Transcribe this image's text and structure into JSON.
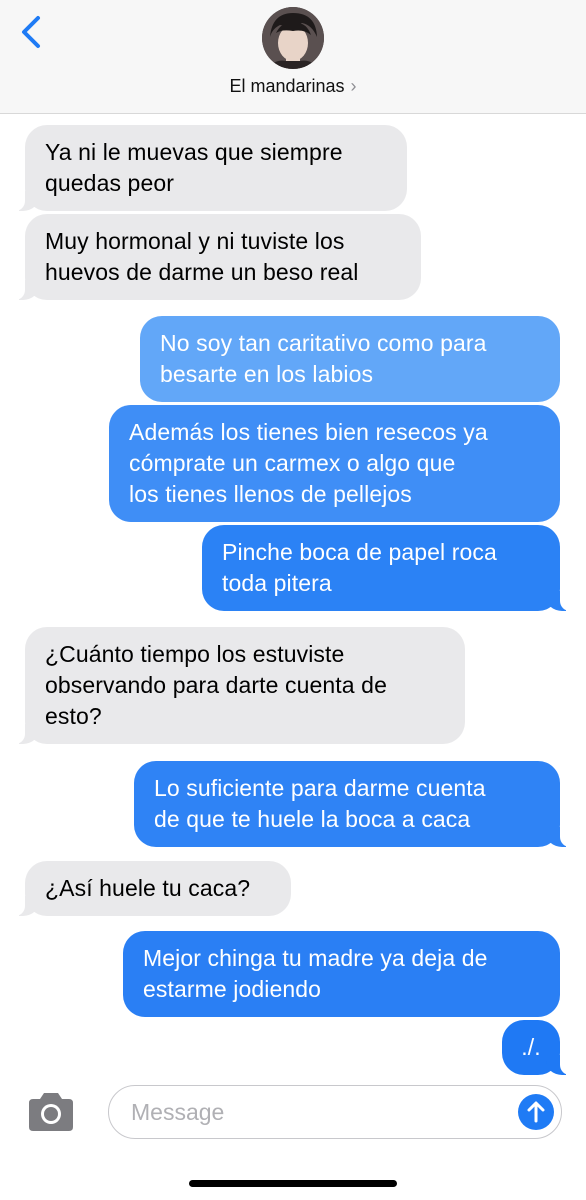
{
  "header": {
    "back_icon": "chevron-left-icon",
    "contact_name": "El mandarinas",
    "contact_chevron": "›",
    "accent": "#1f7bf5"
  },
  "messages": [
    {
      "direction": "incoming",
      "text": "Ya ni le muevas que siempre\nquedas peor"
    },
    {
      "direction": "incoming",
      "text": "Muy hormonal y ni tuviste los\nhuevos de darme un beso real"
    },
    {
      "direction": "outgoing",
      "text": "No soy tan caritativo como para\nbesarte en los labios"
    },
    {
      "direction": "outgoing",
      "text": "Además los tienes bien resecos ya\ncómprate un carmex o algo que\nlos tienes llenos de pellejos"
    },
    {
      "direction": "outgoing",
      "text": "Pinche boca de papel roca\ntoda pitera"
    },
    {
      "direction": "incoming",
      "text": "¿Cuánto tiempo los estuviste\nobservando para darte cuenta de\nesto?"
    },
    {
      "direction": "outgoing",
      "text": "Lo suficiente para darme cuenta\nde que te huele la boca a caca"
    },
    {
      "direction": "incoming",
      "text": "¿Así huele tu caca?"
    },
    {
      "direction": "outgoing",
      "text": "Mejor chinga tu madre ya deja de\nestarme jodiendo"
    },
    {
      "direction": "outgoing",
      "text": "./."
    }
  ],
  "composer": {
    "placeholder": "Message",
    "camera_icon": "camera-icon",
    "send_icon": "arrow-up-icon"
  }
}
